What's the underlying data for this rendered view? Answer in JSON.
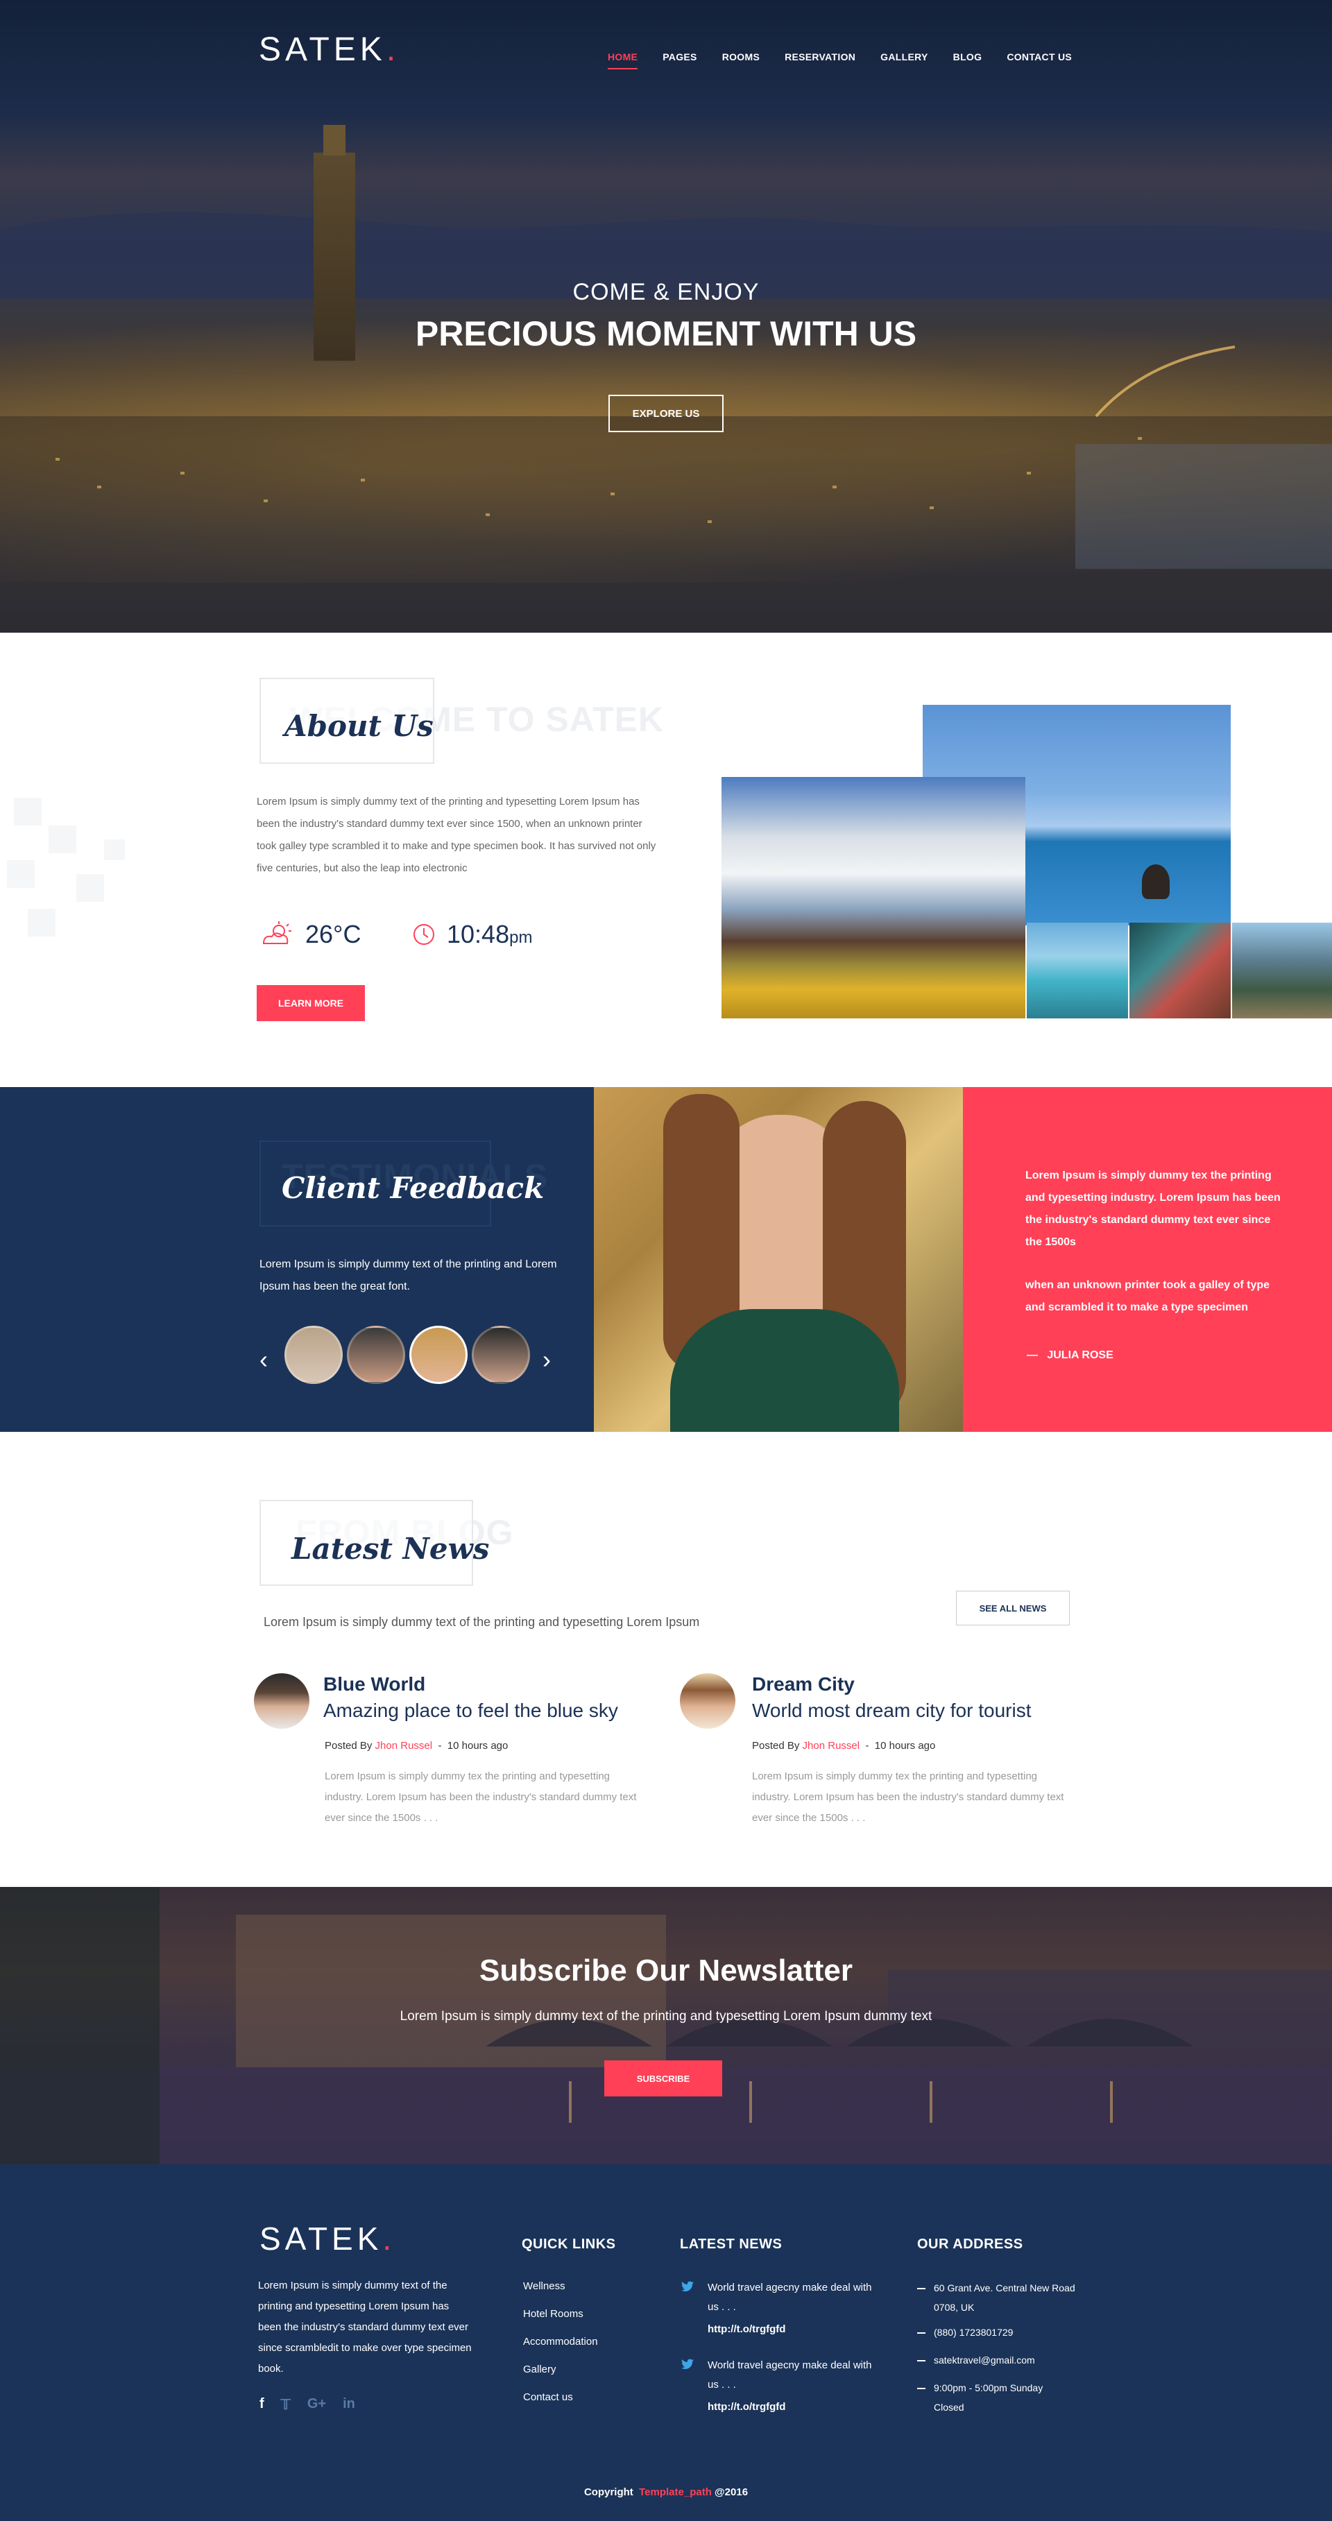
{
  "brand": {
    "logo": "SATEK",
    "dot": "."
  },
  "nav": {
    "items": [
      {
        "label": "HOME",
        "active": true
      },
      {
        "label": "PAGES"
      },
      {
        "label": "ROOMS"
      },
      {
        "label": "RESERVATION"
      },
      {
        "label": "GALLERY"
      },
      {
        "label": "BLOG"
      },
      {
        "label": "CONTACT US"
      }
    ]
  },
  "hero": {
    "subtitle": "COME & ENJOY",
    "title": "PRECIOUS MOMENT WITH US",
    "button": "EXPLORE US"
  },
  "about": {
    "ghost": "WELCOME TO SATEK",
    "title": "About Us",
    "text": "Lorem Ipsum is simply dummy text of the printing and typesetting Lorem Ipsum has been the industry's standard dummy text ever since 1500, when an unknown printer took galley type scrambled it to make and type specimen book. It has survived not only five centuries, but also the leap into electronic",
    "temperature": "26",
    "temp_unit": "°C",
    "time": "10:48",
    "time_suffix": "pm",
    "button": "LEARN MORE"
  },
  "feedback": {
    "ghost": "TESTIMONIALS",
    "title": "Client Feedback",
    "text": "Lorem Ipsum is simply dummy text of the printing and Lorem Ipsum has been the great font.",
    "quote1": "Lorem Ipsum is simply dummy tex the printing and typesetting industry. Lorem Ipsum has been the industry's standard dummy text ever since the 1500s",
    "quote2": "when an unknown printer took a galley of type and scrambled it to make a type specimen",
    "author": "JULIA ROSE",
    "dash": "—"
  },
  "news": {
    "ghost": "FROM BLOG",
    "title": "Latest News",
    "subtitle": "Lorem Ipsum is simply dummy text of the printing and typesetting Lorem Ipsum",
    "see_all": "SEE ALL NEWS",
    "posts": [
      {
        "heading": "Blue World",
        "sub": "Amazing place to feel the blue sky",
        "posted_by": "Posted By",
        "author": "Jhon Russel",
        "sep": "-",
        "time": "10 hours ago",
        "body": "Lorem Ipsum is simply dummy tex the printing and typesetting industry. Lorem Ipsum has been the industry's standard dummy text ever since the 1500s . . ."
      },
      {
        "heading": "Dream City",
        "sub": "World most dream city for tourist",
        "posted_by": "Posted By",
        "author": "Jhon Russel",
        "sep": "-",
        "time": "10 hours ago",
        "body": "Lorem Ipsum is simply dummy tex the printing and typesetting industry. Lorem Ipsum has been the industry's standard dummy text ever since the 1500s . . ."
      }
    ]
  },
  "newsletter": {
    "title": "Subscribe Our Newslatter",
    "text": "Lorem Ipsum is simply dummy text of the printing and typesetting Lorem Ipsum dummy text",
    "button": "SUBSCRIBE"
  },
  "footer": {
    "logo": "SATEK",
    "about": "Lorem Ipsum is simply dummy text of the printing and typesetting Lorem Ipsum has been the industry's standard dummy text ever since scrambledit to make over type specimen book.",
    "quick_links_title": "QUICK LINKS",
    "quick_links": [
      "Wellness",
      "Hotel Rooms",
      "Accommodation",
      "Gallery",
      "Contact us"
    ],
    "latest_news_title": "LATEST NEWS",
    "tweets": [
      {
        "text": "World travel agecny make deal with us . . .",
        "link": "http://t.o/trgfgfd"
      },
      {
        "text": "World travel agecny make deal with us . . .",
        "link": "http://t.o/trgfgfd"
      }
    ],
    "address_title": "OUR ADDRESS",
    "address": [
      "60 Grant Ave. Central New Road 0708, UK",
      "(880) 1723801729",
      "satektravel@gmail.com",
      "9:00pm - 5:00pm Sunday Closed"
    ],
    "social": [
      "facebook-icon",
      "twitter-icon",
      "google-plus-icon",
      "linkedin-icon"
    ],
    "copyright_pre": "Copyright",
    "copyright_link": "Template_path",
    "copyright_post": "@2016"
  },
  "colors": {
    "accent": "#ff4057",
    "navy": "#1b3358",
    "dark_navy": "#14213d"
  }
}
